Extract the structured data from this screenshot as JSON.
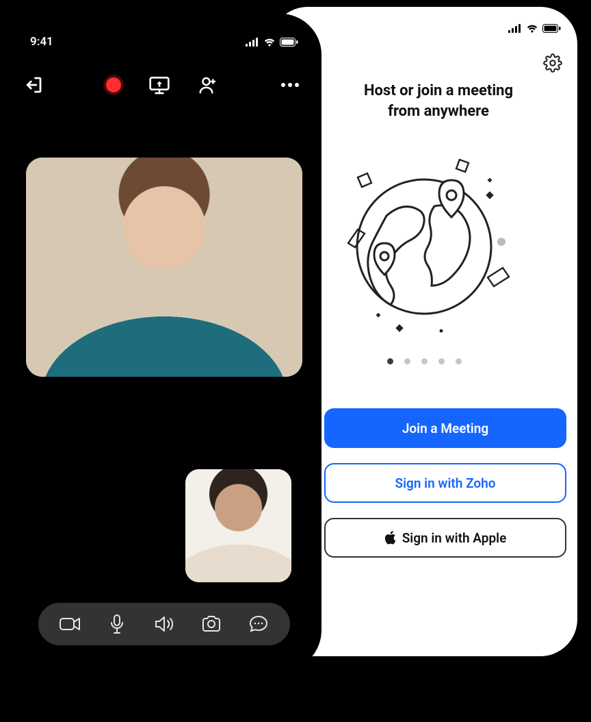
{
  "left_phone": {
    "status_time": "9:41",
    "icons": {
      "exit": "exit-icon",
      "record": "record-icon",
      "share_screen": "share-screen-icon",
      "add_participant": "add-participant-icon",
      "more": "more-icon"
    },
    "controls": {
      "camera": "camera-icon",
      "mic": "mic-icon",
      "speaker": "speaker-icon",
      "switch_camera": "switch-camera-icon",
      "chat": "chat-icon"
    }
  },
  "right_phone": {
    "headline_line1": "Host or join a meeting",
    "headline_line2": "from anywhere",
    "settings_icon": "gear-icon",
    "illustration": "globe-with-pins",
    "pager": {
      "count": 5,
      "active_index": 0
    },
    "buttons": {
      "join_label": "Join a Meeting",
      "zoho_label": "Sign in with Zoho",
      "apple_label": "Sign in with Apple",
      "apple_icon": "apple-icon"
    }
  }
}
